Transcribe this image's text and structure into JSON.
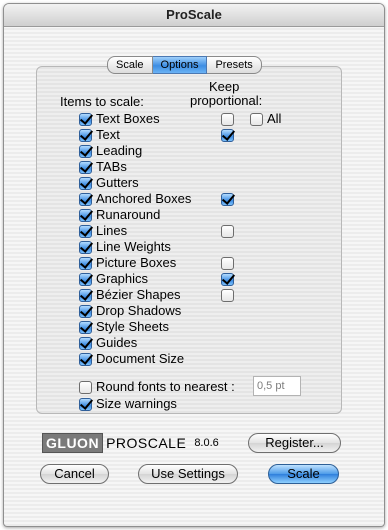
{
  "window": {
    "title": "ProScale"
  },
  "tabs": [
    {
      "label": "Scale"
    },
    {
      "label": "Options",
      "selected": true
    },
    {
      "label": "Presets"
    }
  ],
  "headers": {
    "items_to_scale": "Items to scale:",
    "keep_line1": "Keep",
    "keep_line2": "proportional:",
    "all_label": "All"
  },
  "items": [
    {
      "label": "Text Boxes",
      "checked": true,
      "keep": false
    },
    {
      "label": "Text",
      "checked": true,
      "keep": true
    },
    {
      "label": "Leading",
      "checked": true,
      "keep": null
    },
    {
      "label": "TABs",
      "checked": true,
      "keep": null
    },
    {
      "label": "Gutters",
      "checked": true,
      "keep": null
    },
    {
      "label": "Anchored Boxes",
      "checked": true,
      "keep": true
    },
    {
      "label": "Runaround",
      "checked": true,
      "keep": null
    },
    {
      "label": "Lines",
      "checked": true,
      "keep": false
    },
    {
      "label": "Line Weights",
      "checked": true,
      "keep": null
    },
    {
      "label": "Picture Boxes",
      "checked": true,
      "keep": false
    },
    {
      "label": "Graphics",
      "checked": true,
      "keep": true
    },
    {
      "label": "Bézier Shapes",
      "checked": true,
      "keep": false
    },
    {
      "label": "Drop Shadows",
      "checked": true,
      "keep": null
    },
    {
      "label": "Style Sheets",
      "checked": true,
      "keep": null
    },
    {
      "label": "Guides",
      "checked": true,
      "keep": null
    },
    {
      "label": "Document Size",
      "checked": true,
      "keep": null
    }
  ],
  "keep_all": false,
  "options": {
    "round_fonts": {
      "label": "Round fonts to nearest :",
      "checked": false
    },
    "round_value": "0,5 pt",
    "size_warnings": {
      "label": "Size warnings",
      "checked": true
    }
  },
  "branding": {
    "company": "GLUON",
    "product": "PROSCALE",
    "version": "8.0.6"
  },
  "buttons": {
    "register": "Register...",
    "cancel": "Cancel",
    "use_settings": "Use Settings",
    "scale": "Scale"
  }
}
